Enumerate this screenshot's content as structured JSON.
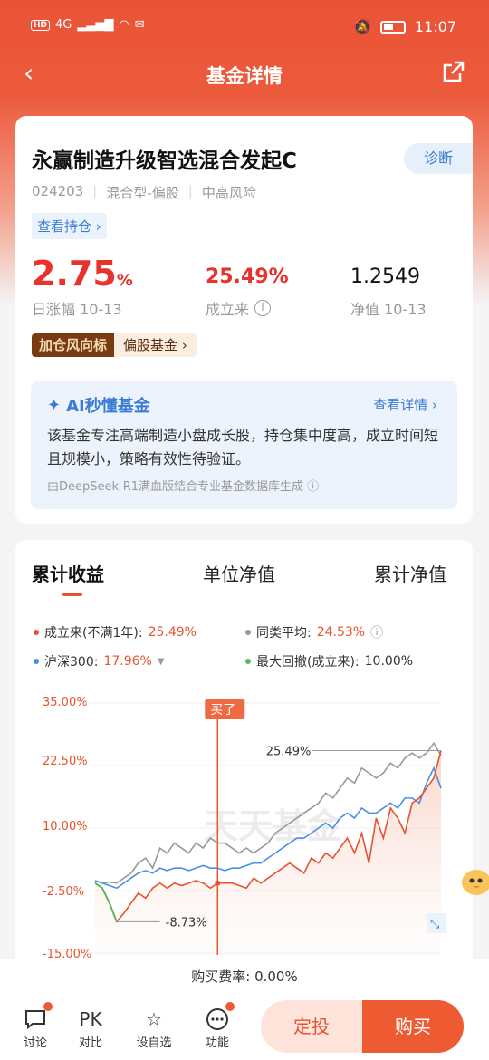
{
  "status": {
    "time": "11:07",
    "net": "4G"
  },
  "nav": {
    "title": "基金详情"
  },
  "fund": {
    "name": "永赢制造升级智选混合发起C",
    "diagnose": "诊断",
    "code": "024203",
    "type": "混合型-偏股",
    "risk": "中高风险",
    "holdings_link": "查看持仓",
    "day_change": "2.75",
    "day_change_unit": "%",
    "day_change_label": "日涨幅 10-13",
    "since_inception": "25.49%",
    "since_inception_label": "成立来",
    "nav": "1.2549",
    "nav_label": "净值 10-13",
    "tag_dark": "加仓风向标",
    "tag_light": "偏股基金"
  },
  "ai": {
    "title": "AI秒懂基金",
    "link": "查看详情",
    "text": "该基金专注高端制造小盘成长股，持仓集中度高，成立时间短且规模小，策略有效性待验证。",
    "source": "由DeepSeek-R1满血版结合专业基金数据库生成"
  },
  "chart_tabs": [
    "累计收益",
    "单位净值",
    "累计净值"
  ],
  "legend": {
    "fund": {
      "label": "成立来(不满1年):",
      "value": "25.49%",
      "color": "#e8532f"
    },
    "peer": {
      "label": "同类平均:",
      "value": "24.53%",
      "color": "#999999"
    },
    "index": {
      "label": "沪深300:",
      "value": "17.96%",
      "color": "#4a90e2"
    },
    "drawdown": {
      "label": "最大回撤(成立来):",
      "value": "10.00%",
      "color": "#5cb85c"
    }
  },
  "chart_data": {
    "type": "line",
    "ylim": [
      -15,
      35
    ],
    "yticks": [
      "35.00%",
      "22.50%",
      "10.00%",
      "-2.50%",
      "-15.00%"
    ],
    "buy_marker": "买了",
    "annotations": {
      "max": "25.49%",
      "min": "-8.73%"
    },
    "watermark": "天天基金",
    "series": [
      {
        "name": "成立来(不满1年)",
        "color": "#e8532f",
        "values": [
          -1,
          -2,
          -5,
          -8.73,
          -7,
          -5,
          -3,
          -4,
          -2,
          -1,
          -2,
          -1,
          -1.5,
          -1,
          -0.5,
          -1,
          -2,
          -1,
          -1,
          -1,
          -1.5,
          -2,
          0,
          -1,
          0,
          1,
          2,
          3,
          2,
          1,
          4,
          3,
          5,
          4,
          6,
          8,
          5,
          9,
          3,
          12,
          8,
          14,
          12,
          9,
          15,
          16,
          18,
          20,
          25.49
        ]
      },
      {
        "name": "同类平均",
        "color": "#999999",
        "values": [
          -0.5,
          -1,
          -0.8,
          -1,
          0,
          1,
          3,
          4,
          2,
          6,
          5,
          7,
          6,
          5,
          7,
          6,
          8,
          7,
          7,
          6,
          5,
          6,
          5,
          6,
          7,
          9,
          10,
          11,
          12,
          13,
          14,
          15,
          17,
          16,
          18,
          20,
          19,
          22,
          21,
          20,
          21,
          23,
          22,
          24,
          25,
          24,
          25,
          27,
          24.53
        ]
      },
      {
        "name": "沪深300",
        "color": "#4a90e2",
        "values": [
          -0.5,
          -1,
          -1.5,
          -2,
          -1,
          0,
          1,
          1.5,
          1,
          2,
          1.5,
          2,
          2,
          1.5,
          2,
          2.5,
          2,
          2,
          1.5,
          2,
          2,
          2.5,
          3,
          3,
          4,
          5,
          6,
          7,
          8,
          8,
          9,
          10,
          11,
          10,
          12,
          13,
          12,
          14,
          13,
          13,
          14,
          15,
          14,
          16,
          16,
          15,
          19,
          22,
          17.96
        ]
      }
    ]
  },
  "fee": {
    "text": "购买费率: 0.00%"
  },
  "bottom": {
    "discuss": "讨论",
    "pk": "PK",
    "compare": "对比",
    "watch": "设自选",
    "func": "功能",
    "fixed": "定投",
    "buy": "购买"
  }
}
